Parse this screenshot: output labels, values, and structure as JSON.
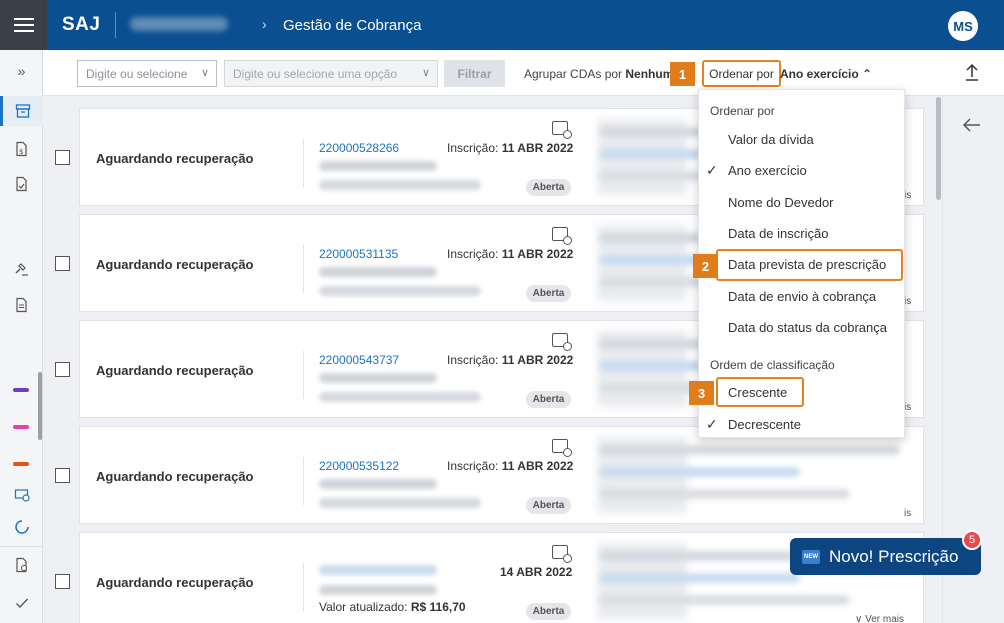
{
  "header": {
    "app_name": "SAJ",
    "breadcrumb_chevron": "›",
    "page_title": "Gestão de Cobrança",
    "user_initials": "MS"
  },
  "sidebar": {
    "expand_icon": "»"
  },
  "filters": {
    "select1_placeholder": "Digite ou selecione",
    "select2_placeholder": "Digite ou selecione uma opção",
    "filter_button": "Filtrar",
    "group_label": "Agrupar CDAs por",
    "group_value": "Nenhum",
    "order_label": "Ordenar por",
    "order_value": "Ano exercício",
    "order_chevron": "⌃"
  },
  "steps": [
    "1",
    "2",
    "3"
  ],
  "dropdown": {
    "section_order": "Ordenar por",
    "order_options": [
      "Valor da dívida",
      "Ano exercício",
      "Nome do Devedor",
      "Data de inscrição",
      "Data prevista de prescrição",
      "Data de envio à cobrança",
      "Data do status da cobrança"
    ],
    "section_sort": "Ordem de classificação",
    "sort_options": [
      "Crescente",
      "Decrescente"
    ],
    "check": "✓"
  },
  "cards": [
    {
      "status": "Aguardando recuperação",
      "number": "220000528266",
      "insc_label": "Inscrição:",
      "insc_date": "11 ABR 2022",
      "tag": "Aberta",
      "more": "is"
    },
    {
      "status": "Aguardando recuperação",
      "number": "220000531135",
      "insc_label": "Inscrição:",
      "insc_date": "11 ABR 2022",
      "tag": "Aberta",
      "more": "is"
    },
    {
      "status": "Aguardando recuperação",
      "number": "220000543737",
      "insc_label": "Inscrição:",
      "insc_date": "11 ABR 2022",
      "tag": "Aberta",
      "more": "is"
    },
    {
      "status": "Aguardando recuperação",
      "number": "220000535122",
      "insc_label": "Inscrição:",
      "insc_date": "11 ABR 2022",
      "tag": "Aberta",
      "more": "is"
    },
    {
      "status": "Aguardando recuperação",
      "number": "",
      "insc_label": "",
      "insc_date": "14 ABR 2022",
      "tag": "Aberta",
      "valor_label": "Valor atualizado:",
      "valor": "R$ 116,70",
      "more": "Ver mais"
    }
  ],
  "novo": {
    "new_icon": "NEW",
    "label": "Novo! Prescrição",
    "badge": "5"
  },
  "colors": {
    "primary": "#0a4f8f",
    "highlight": "#e4821e",
    "link": "#1a73c7"
  }
}
